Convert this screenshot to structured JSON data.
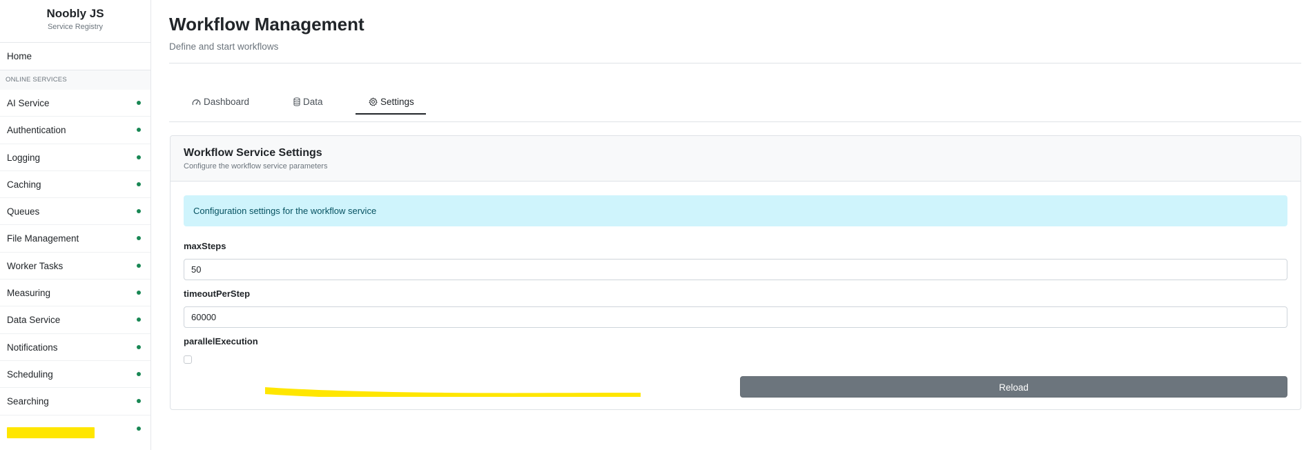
{
  "sidebar": {
    "brand_title": "Noobly JS",
    "brand_subtitle": "Service Registry",
    "home_label": "Home",
    "section_label": "ONLINE SERVICES",
    "status_color": "#198754",
    "items": [
      {
        "label": "AI Service"
      },
      {
        "label": "Authentication"
      },
      {
        "label": "Logging"
      },
      {
        "label": "Caching"
      },
      {
        "label": "Queues"
      },
      {
        "label": "File Management"
      },
      {
        "label": "Worker Tasks"
      },
      {
        "label": "Measuring"
      },
      {
        "label": "Data Service"
      },
      {
        "label": "Notifications"
      },
      {
        "label": "Scheduling"
      },
      {
        "label": "Searching"
      },
      {
        "label": ""
      }
    ]
  },
  "header": {
    "title": "Workflow Management",
    "subtitle": "Define and start workflows"
  },
  "tabs": [
    {
      "label": "Dashboard",
      "icon": "dashboard-gauge-icon"
    },
    {
      "label": "Data",
      "icon": "database-icon"
    },
    {
      "label": "Settings",
      "icon": "gear-icon",
      "active": true
    }
  ],
  "settings_card": {
    "title": "Workflow Service Settings",
    "description": "Configure the workflow service parameters",
    "info_text": "Configuration settings for the workflow service",
    "fields": {
      "max_steps": {
        "label": "maxSteps",
        "value": "50"
      },
      "timeout_per_step": {
        "label": "timeoutPerStep",
        "value": "60000"
      },
      "parallel_execution": {
        "label": "parallelExecution",
        "checked": false
      }
    },
    "reload_label": "Reload"
  },
  "colors": {
    "accent_info_bg": "#cff4fc",
    "info_text": "#055160",
    "secondary_button": "#6c757d",
    "redaction": "#ffe600"
  }
}
